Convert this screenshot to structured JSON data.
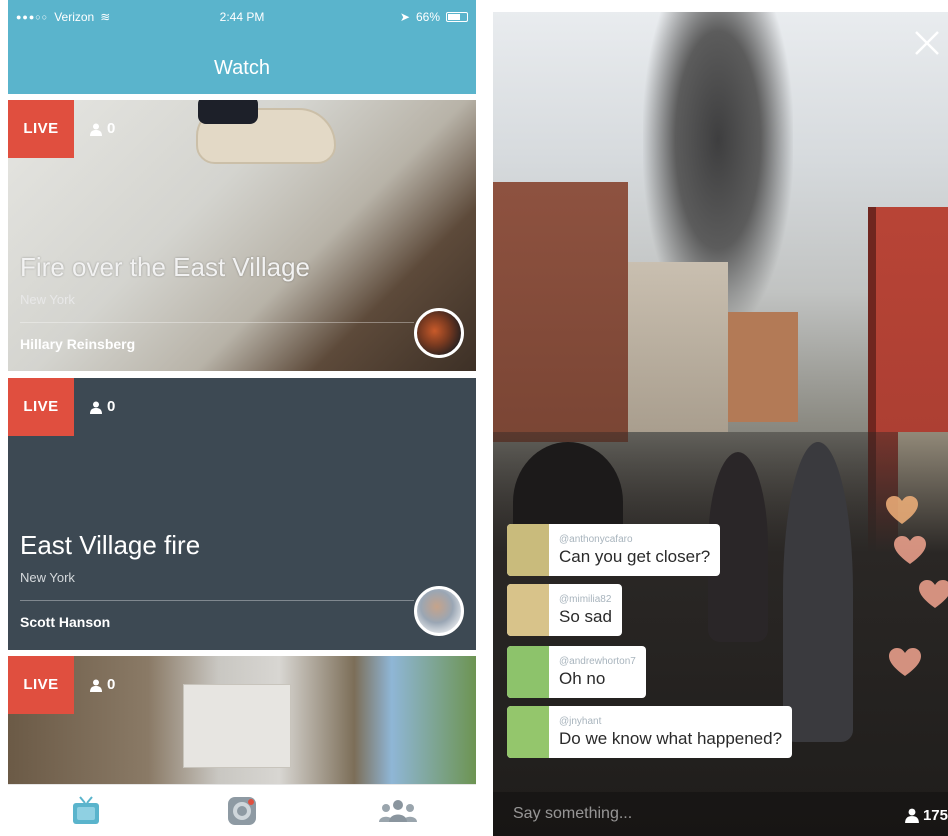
{
  "status_bar": {
    "carrier": "Verizon",
    "time": "2:44 PM",
    "battery": "66%"
  },
  "nav": {
    "title": "Watch"
  },
  "cards": [
    {
      "live_label": "LIVE",
      "viewers": "0",
      "title": "Fire over the East Village",
      "city": "New York",
      "user": "Hillary Reinsberg"
    },
    {
      "live_label": "LIVE",
      "viewers": "0",
      "title": "East Village fire",
      "city": "New York",
      "user": "Scott Hanson"
    },
    {
      "live_label": "LIVE",
      "viewers": "0"
    }
  ],
  "tab_bar": {
    "tabs": [
      {
        "icon": "tv-icon"
      },
      {
        "icon": "camera-broadcast-icon"
      },
      {
        "icon": "people-icon"
      }
    ]
  },
  "broadcast": {
    "comments": [
      {
        "user": "@anthonycafaro",
        "message": "Can you get closer?"
      },
      {
        "user": "@mimilia82",
        "message": "So sad"
      },
      {
        "user": "@andrewhorton7",
        "message": "Oh no"
      },
      {
        "user": "@jnyhant",
        "message": "Do we know what happened?"
      }
    ],
    "input_placeholder": "Say something...",
    "viewer_count": "175"
  },
  "colors": {
    "brand": "#5ab4cc",
    "live": "#e04f3f",
    "card_dark": "#3d4953",
    "heart": "#f2b27a"
  }
}
